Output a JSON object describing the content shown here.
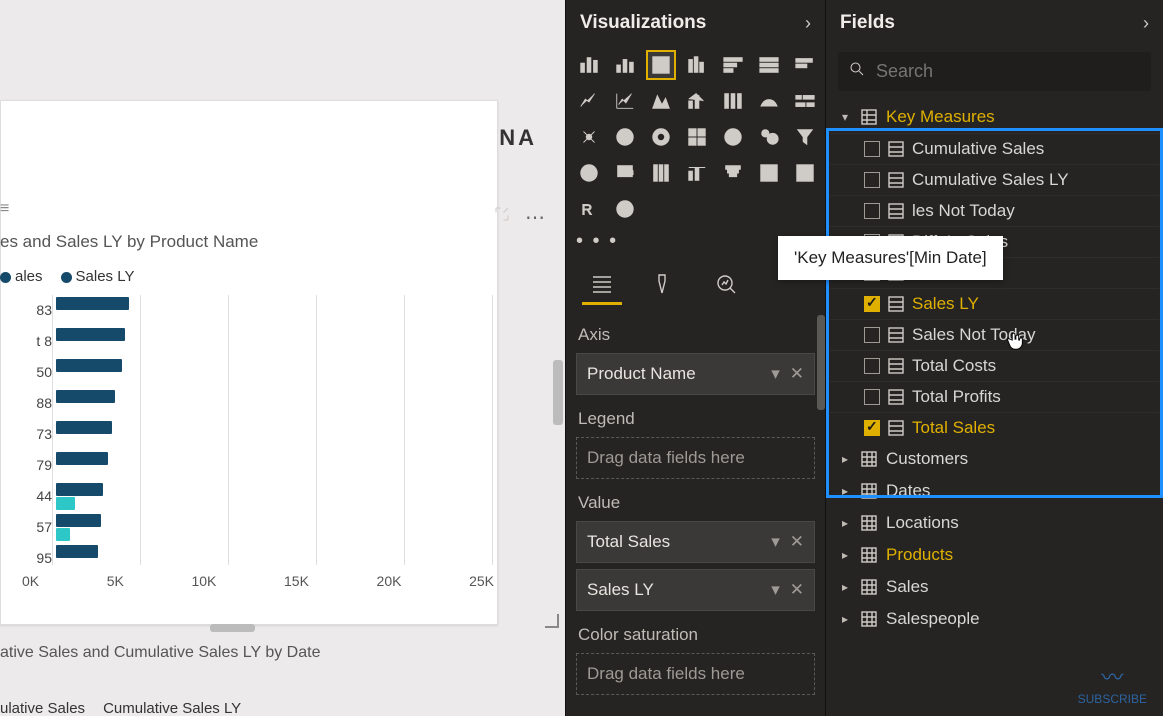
{
  "logo_text": "ENTERPRISE DNA",
  "chart1": {
    "title": "es and Sales LY by Product Name",
    "legend": [
      "ales",
      "Sales LY"
    ]
  },
  "chart_data": {
    "type": "bar",
    "orientation": "horizontal",
    "categories": [
      "83",
      "t 8",
      "50",
      "88",
      "73",
      "79",
      "44",
      "57",
      "95"
    ],
    "x_ticks": [
      "0K",
      "5K",
      "10K",
      "15K",
      "20K",
      "25K"
    ],
    "xlim": [
      0,
      25000
    ],
    "series": [
      {
        "name": "ales",
        "color": "#164a6a",
        "values": [
          4200,
          4000,
          3800,
          3400,
          3200,
          3000,
          2700,
          2600,
          2400
        ]
      },
      {
        "name": "Sales LY",
        "color": "#2dc7c7",
        "values": [
          null,
          null,
          null,
          null,
          null,
          null,
          1100,
          800,
          null
        ]
      }
    ]
  },
  "chart2": {
    "title": "ative Sales and Cumulative Sales LY by Date",
    "legend": [
      "ulative Sales",
      "Cumulative Sales LY"
    ]
  },
  "visualizations": {
    "header": "Visualizations",
    "tabs": [
      "fields",
      "format",
      "analytics"
    ],
    "wells": {
      "axis_label": "Axis",
      "axis_value": "Product Name",
      "legend_label": "Legend",
      "legend_placeholder": "Drag data fields here",
      "value_label": "Value",
      "value_items": [
        "Total Sales",
        "Sales LY"
      ],
      "color_label": "Color saturation",
      "color_placeholder": "Drag data fields here"
    }
  },
  "fields": {
    "header": "Fields",
    "search_placeholder": "Search",
    "tooltip": "'Key Measures'[Min Date]",
    "key_measures_label": "Key Measures",
    "measures": [
      {
        "name": "Cumulative Sales",
        "checked": false
      },
      {
        "name": "Cumulative Sales LY",
        "checked": false
      },
      {
        "name": "les Not Today",
        "checked": false,
        "truncated": true
      },
      {
        "name": "Diff. In Sales",
        "checked": false,
        "obscured": true
      },
      {
        "name": "Min Date",
        "checked": false
      },
      {
        "name": "Sales LY",
        "checked": true
      },
      {
        "name": "Sales Not Today",
        "checked": false
      },
      {
        "name": "Total Costs",
        "checked": false
      },
      {
        "name": "Total Profits",
        "checked": false
      },
      {
        "name": "Total Sales",
        "checked": true
      }
    ],
    "tables": [
      {
        "name": "Customers",
        "active": false
      },
      {
        "name": "Dates",
        "active": false
      },
      {
        "name": "Locations",
        "active": false
      },
      {
        "name": "Products",
        "active": true
      },
      {
        "name": "Sales",
        "active": false
      },
      {
        "name": "Salespeople",
        "active": false
      }
    ]
  },
  "subscribe": "SUBSCRIBE"
}
